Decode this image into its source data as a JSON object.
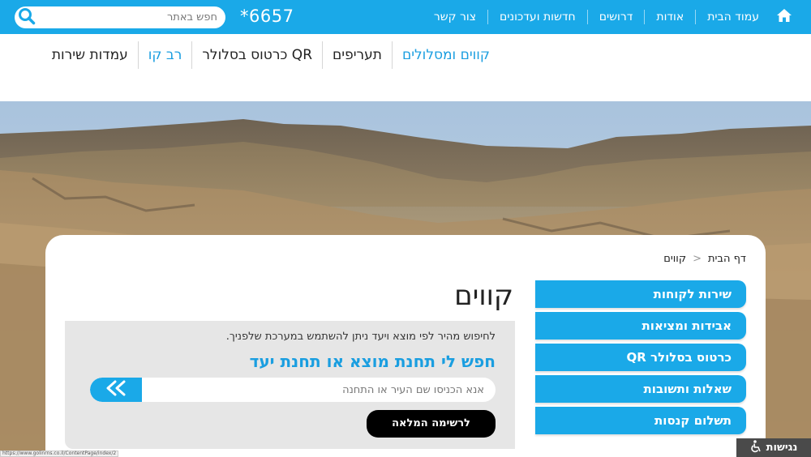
{
  "topbar": {
    "search_placeholder": "חפש באתר",
    "phone": "*6657",
    "nav": [
      "עמוד הבית",
      "אודות",
      "דרושים",
      "חדשות ועדכונים",
      "צור קשר"
    ],
    "color": "#1aa9e8"
  },
  "mainnav": {
    "items": [
      "קווים ומסלולים",
      "תעריפים",
      "כרטוס בסלולר QR",
      "רב קו",
      "עמדות שירות"
    ]
  },
  "breadcrumb": {
    "home": "דף הבית",
    "separator": "<",
    "current": "קווים"
  },
  "sidebar": {
    "items": [
      "שירות לקוחות",
      "אבידות ומציאות",
      "כרטוס בסלולר QR",
      "שאלות ותשובות",
      "תשלום קנסות"
    ]
  },
  "main": {
    "title": "קווים",
    "hint": "לחיפוש מהיר לפי מוצא ויעד ניתן להשתמש במערכת שלפניך.",
    "heading": "חפש לי תחנת מוצא או תחנת יעד",
    "station_placeholder": "אנא הכניסו שם העיר או התחנה",
    "full_list_button": "לרשימה המלאה"
  },
  "accessibility": {
    "label": "נגישות",
    "icon": "wheelchair-icon"
  },
  "status_url": "https://www.golinrns.co.il/ContentPage/index/2"
}
